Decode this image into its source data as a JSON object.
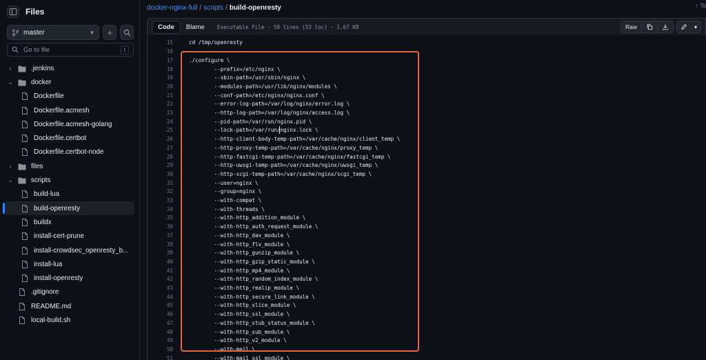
{
  "sidebar": {
    "title": "Files",
    "branch": "master",
    "goto_placeholder": "Go to file",
    "goto_shortcut": "t",
    "tree": [
      {
        "label": ".jenkins",
        "kind": "folder",
        "depth": 0,
        "expanded": false
      },
      {
        "label": "docker",
        "kind": "folder",
        "depth": 0,
        "expanded": true
      },
      {
        "label": "Dockerfile",
        "kind": "file",
        "depth": 1
      },
      {
        "label": "Dockerfile.acmesh",
        "kind": "file",
        "depth": 1
      },
      {
        "label": "Dockerfile.acmesh-golang",
        "kind": "file",
        "depth": 1
      },
      {
        "label": "Dockerfile.certbot",
        "kind": "file",
        "depth": 1
      },
      {
        "label": "Dockerfile.certbot-node",
        "kind": "file",
        "depth": 1
      },
      {
        "label": "files",
        "kind": "folder",
        "depth": 0,
        "expanded": false
      },
      {
        "label": "scripts",
        "kind": "folder",
        "depth": 0,
        "expanded": true
      },
      {
        "label": "build-lua",
        "kind": "file",
        "depth": 1
      },
      {
        "label": "build-openresty",
        "kind": "file",
        "depth": 1,
        "active": true
      },
      {
        "label": "buildx",
        "kind": "file",
        "depth": 1
      },
      {
        "label": "install-cert-prune",
        "kind": "file",
        "depth": 1
      },
      {
        "label": "install-crowdsec_openresty_b...",
        "kind": "file",
        "depth": 1
      },
      {
        "label": "install-lua",
        "kind": "file",
        "depth": 1
      },
      {
        "label": "install-openresty",
        "kind": "file",
        "depth": 1
      },
      {
        "label": ".gitignore",
        "kind": "file",
        "depth": 0
      },
      {
        "label": "README.md",
        "kind": "file",
        "depth": 0
      },
      {
        "label": "local-build.sh",
        "kind": "file",
        "depth": 0
      }
    ]
  },
  "breadcrumb": {
    "repo": "docker-nginx-full",
    "folder": "scripts",
    "file": "build-openresty",
    "top_right": "To"
  },
  "filebar": {
    "code_tab": "Code",
    "blame_tab": "Blame",
    "meta": "Executable File · 59 lines (53 loc) · 1.67 KB",
    "raw_label": "Raw"
  },
  "code": {
    "lines": [
      {
        "n": "15",
        "text": "cd /tmp/openresty"
      },
      {
        "n": "16",
        "text": ""
      },
      {
        "n": "17",
        "text": "./configure \\"
      },
      {
        "n": "18",
        "text": "        --prefix=/etc/nginx \\"
      },
      {
        "n": "19",
        "text": "        --sbin-path=/usr/sbin/nginx \\"
      },
      {
        "n": "20",
        "text": "        --modules-path=/usr/lib/nginx/modules \\"
      },
      {
        "n": "21",
        "text": "        --conf-path=/etc/nginx/nginx.conf \\"
      },
      {
        "n": "22",
        "text": "        --error-log-path=/var/log/nginx/error.log \\"
      },
      {
        "n": "23",
        "text": "        --http-log-path=/var/log/nginx/access.log \\"
      },
      {
        "n": "24",
        "text": "        --pid-path=/var/run/nginx.pid \\"
      },
      {
        "n": "25",
        "text": "        --lock-path=/var/run/nginx.lock \\"
      },
      {
        "n": "26",
        "text": "        --http-client-body-temp-path=/var/cache/nginx/client_temp \\"
      },
      {
        "n": "27",
        "text": "        --http-proxy-temp-path=/var/cache/nginx/proxy_temp \\"
      },
      {
        "n": "28",
        "text": "        --http-fastcgi-temp-path=/var/cache/nginx/fastcgi_temp \\"
      },
      {
        "n": "29",
        "text": "        --http-uwsgi-temp-path=/var/cache/nginx/uwsgi_temp \\"
      },
      {
        "n": "30",
        "text": "        --http-scgi-temp-path=/var/cache/nginx/scgi_temp \\"
      },
      {
        "n": "31",
        "text": "        --user=nginx \\"
      },
      {
        "n": "32",
        "text": "        --group=nginx \\"
      },
      {
        "n": "33",
        "text": "        --with-compat \\"
      },
      {
        "n": "34",
        "text": "        --with-threads \\"
      },
      {
        "n": "35",
        "text": "        --with-http_addition_module \\"
      },
      {
        "n": "36",
        "text": "        --with-http_auth_request_module \\"
      },
      {
        "n": "37",
        "text": "        --with-http_dav_module \\"
      },
      {
        "n": "38",
        "text": "        --with-http_flv_module \\"
      },
      {
        "n": "39",
        "text": "        --with-http_gunzip_module \\"
      },
      {
        "n": "40",
        "text": "        --with-http_gzip_static_module \\"
      },
      {
        "n": "41",
        "text": "        --with-http_mp4_module \\"
      },
      {
        "n": "42",
        "text": "        --with-http_random_index_module \\"
      },
      {
        "n": "43",
        "text": "        --with-http_realip_module \\"
      },
      {
        "n": "44",
        "text": "        --with-http_secure_link_module \\"
      },
      {
        "n": "45",
        "text": "        --with-http_slice_module \\"
      },
      {
        "n": "46",
        "text": "        --with-http_ssl_module \\"
      },
      {
        "n": "47",
        "text": "        --with-http_stub_status_module \\"
      },
      {
        "n": "48",
        "text": "        --with-http_sub_module \\"
      },
      {
        "n": "49",
        "text": "        --with-http_v2_module \\"
      },
      {
        "n": "50",
        "text": "        --with-mail \\"
      },
      {
        "n": "51",
        "text": "        --with-mail_ssl_module \\"
      }
    ]
  },
  "colors": {
    "background": "#0d1117",
    "accent_link": "#4493f8",
    "highlight_box": "#e8663d",
    "active_indicator": "#2f81f7"
  }
}
